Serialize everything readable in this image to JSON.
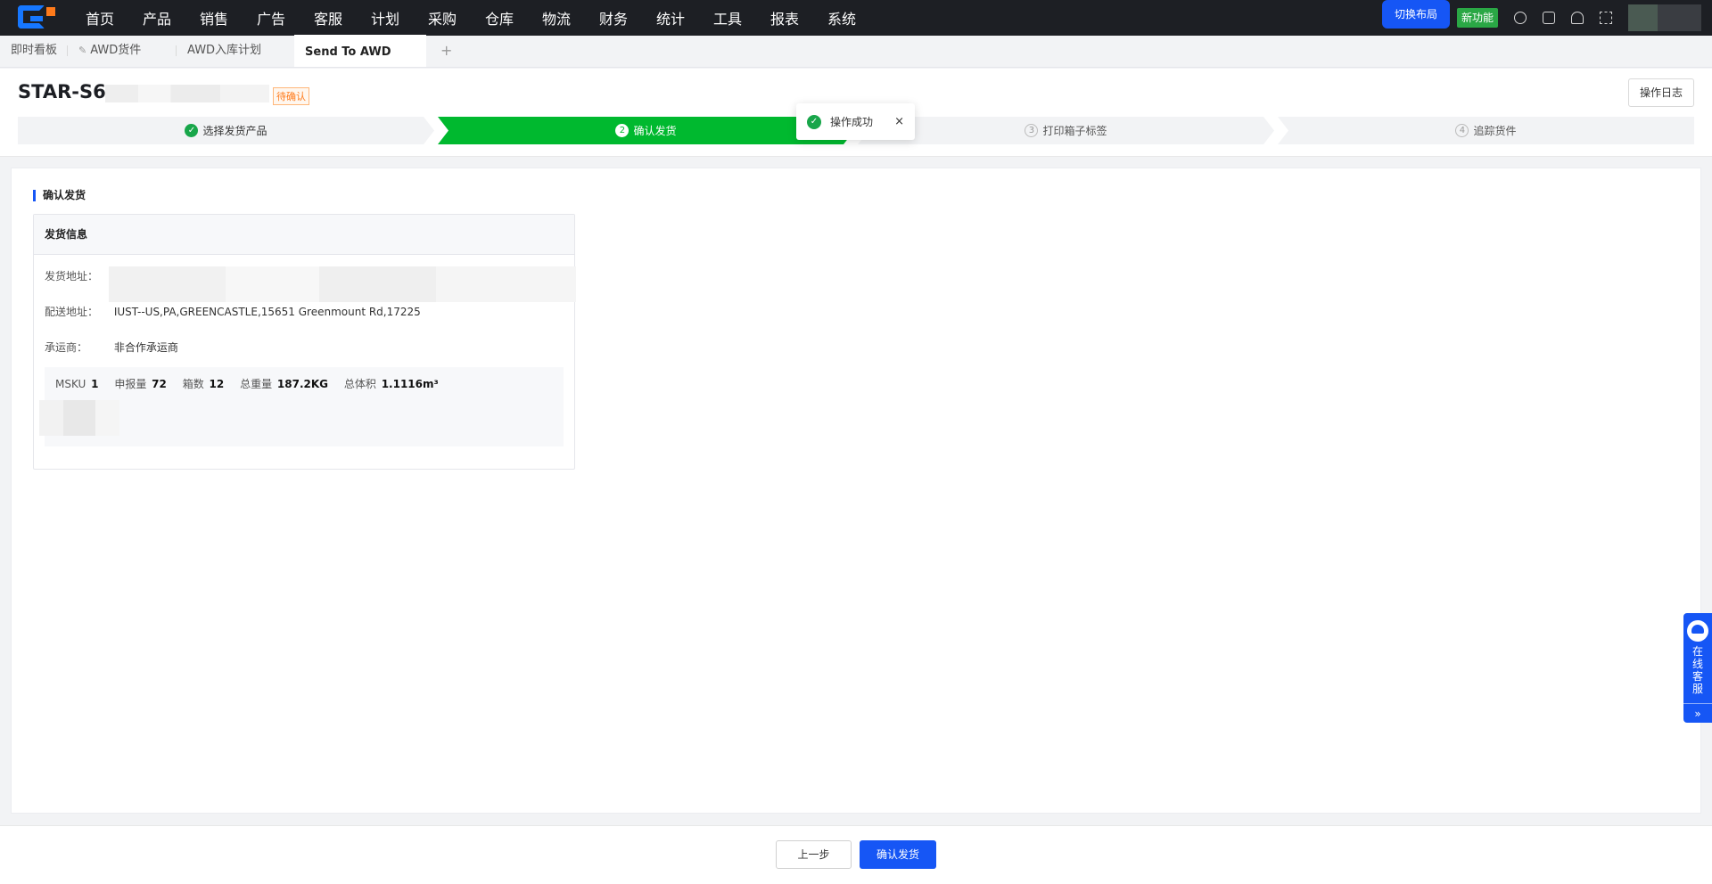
{
  "nav": {
    "menu": [
      "首页",
      "产品",
      "销售",
      "广告",
      "客服",
      "计划",
      "采购",
      "仓库",
      "物流",
      "财务",
      "统计",
      "工具",
      "报表",
      "系统"
    ],
    "switch_layout": "切换布局",
    "new_feature": "新功能"
  },
  "tabs": {
    "t1": "即时看板",
    "t2": "AWD货件",
    "t3": "AWD入库计划",
    "t4": "Send To AWD",
    "add": "+"
  },
  "header": {
    "title": "STAR-S6",
    "status": "待确认",
    "log_button": "操作日志"
  },
  "steps": {
    "s1": "选择发货产品",
    "s2_num": "2",
    "s2": "确认发货",
    "s3_num": "3",
    "s3": "打印箱子标签",
    "s4_num": "4",
    "s4": "追踪货件"
  },
  "toast": {
    "message": "操作成功",
    "close": "×"
  },
  "main": {
    "section_title": "确认发货",
    "card_title": "发货信息",
    "ship_from_label": "发货地址：",
    "ship_to_label": "配送地址：",
    "ship_to_value": "IUST--US,PA,GREENCASTLE,15651 Greenmount Rd,17225",
    "carrier_label": "承运商：",
    "carrier_value": "非合作承运商",
    "summary": {
      "msku_label": "MSKU",
      "msku_value": "1",
      "qty_label": "申报量",
      "qty_value": "72",
      "boxes_label": "箱数",
      "boxes_value": "12",
      "weight_label": "总重量",
      "weight_value": "187.2KG",
      "volume_label": "总体积",
      "volume_value": "1.1116m³"
    }
  },
  "footer": {
    "prev": "上一步",
    "confirm": "确认发货"
  },
  "service": {
    "label": "在线客服",
    "arrow": "»"
  }
}
